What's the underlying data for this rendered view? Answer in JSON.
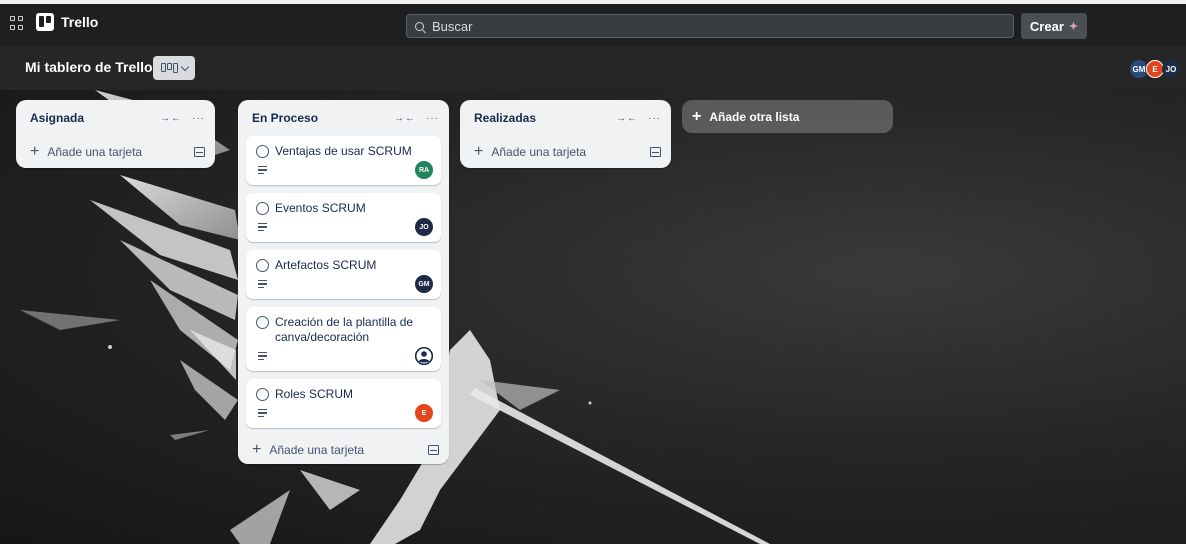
{
  "topbar": {
    "app_name": "Trello",
    "search_placeholder": "Buscar",
    "create_label": "Crear"
  },
  "board": {
    "title": "Mi tablero de Trello",
    "members": [
      "GM",
      "E",
      "JO"
    ]
  },
  "lists": [
    {
      "title": "Asignada",
      "add_card_label": "Añade una tarjeta",
      "cards": []
    },
    {
      "title": "En Proceso",
      "add_card_label": "Añade una tarjeta",
      "cards": [
        {
          "title": "Ventajas de usar SCRUM",
          "member": "RA",
          "member_color": "#1f845a"
        },
        {
          "title": "Eventos SCRUM",
          "member": "JO",
          "member_color": "#1f2a44"
        },
        {
          "title": "Artefactos SCRUM",
          "member": "GM",
          "member_color": "#1f2a44"
        },
        {
          "title": "Creación de la plantilla de canva/decoración",
          "member": "",
          "member_icon": "person-icon"
        },
        {
          "title": "Roles SCRUM",
          "member": "E",
          "member_color": "#e2461d"
        }
      ]
    },
    {
      "title": "Realizadas",
      "add_card_label": "Añade una tarjeta",
      "cards": []
    }
  ],
  "add_list_label": "Añade otra lista",
  "icons": {
    "collapse": "collapse-arrows-icon",
    "more": "more-dots-icon",
    "template": "card-template-icon",
    "description": "description-lines-icon",
    "apps": "apps-grid-icon",
    "search": "search-icon",
    "view": "board-view-icon"
  }
}
